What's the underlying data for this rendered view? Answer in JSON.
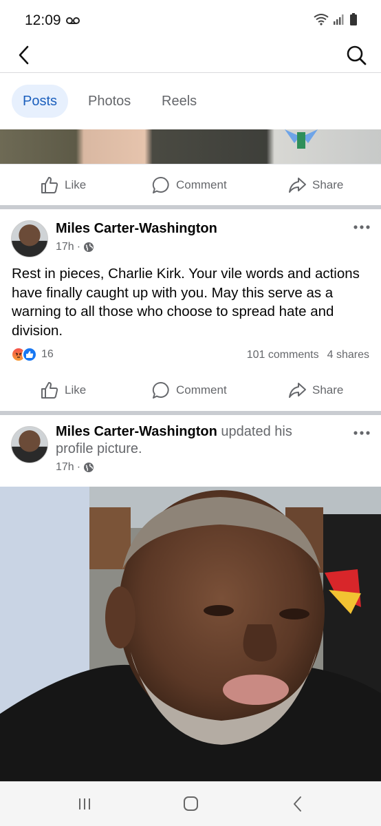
{
  "status_bar": {
    "time": "12:09"
  },
  "header": {
    "back_icon": "chevron-left-icon",
    "search_icon": "search-icon"
  },
  "tabs": [
    {
      "label": "Posts",
      "active": true
    },
    {
      "label": "Photos",
      "active": false
    },
    {
      "label": "Reels",
      "active": false
    }
  ],
  "actions": {
    "like": "Like",
    "comment": "Comment",
    "share": "Share"
  },
  "post1": {
    "author": "Miles Carter-Washington",
    "time": "17h",
    "text": "Rest in pieces, Charlie Kirk. Your vile words and actions have finally caught up with you. May this serve as a warning to all those who choose to spread hate and division.",
    "reaction_count": "16",
    "comments": "101 comments",
    "shares": "4 shares"
  },
  "post2": {
    "author": "Miles Carter-Washington",
    "action": "updated his profile picture.",
    "time": "17h"
  },
  "colors": {
    "accent": "#1b5fbd",
    "tab_active_bg": "#e7f0fd",
    "secondary_text": "#65676b",
    "divider": "#c9ccd1"
  }
}
